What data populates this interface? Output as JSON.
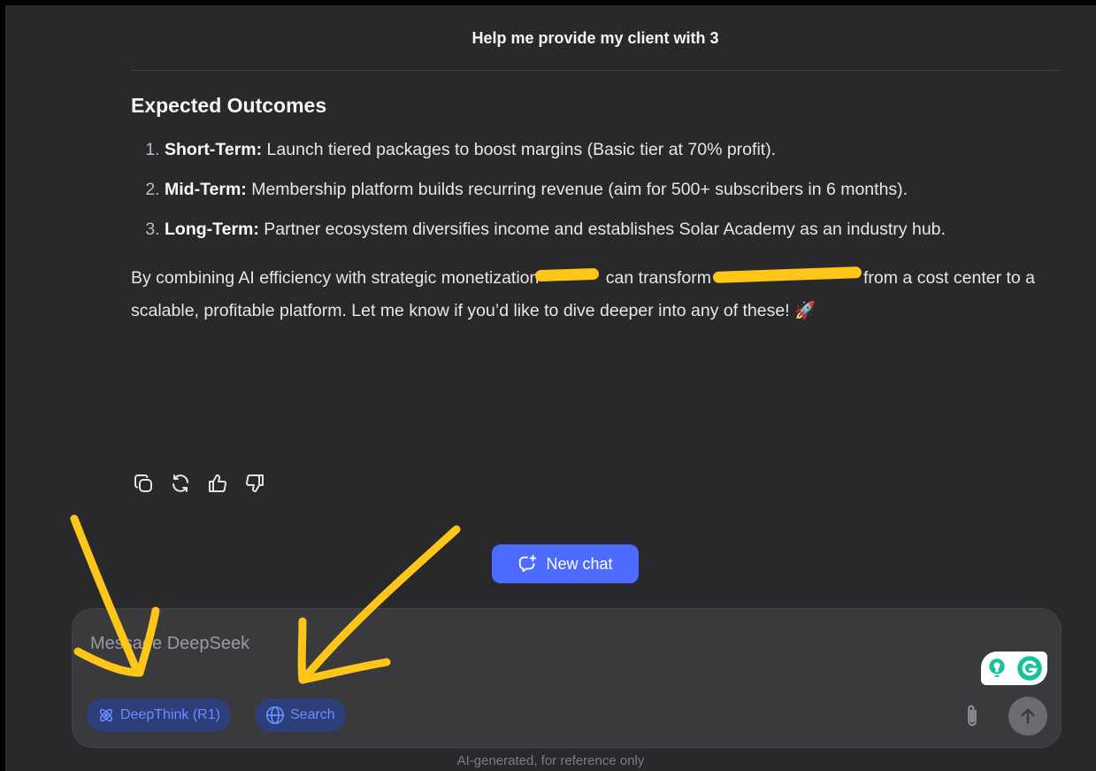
{
  "header": {
    "title": "Help me provide my client with 3"
  },
  "message": {
    "heading": "Expected Outcomes",
    "outcomes": [
      {
        "label": "Short-Term:",
        "text": " Launch tiered packages to boost margins (Basic tier at 70% profit)."
      },
      {
        "label": "Mid-Term:",
        "text": " Membership platform builds recurring revenue (aim for 500+ subscribers in 6 months)."
      },
      {
        "label": "Long-Term:",
        "text": " Partner ecosystem diversifies income and establishes Solar Academy as an industry hub."
      }
    ],
    "closing_part1": "By combining AI efficiency with strategic monetization",
    "closing_part2": " can transform",
    "closing_part3": "from a cost center to a scalable, profitable platform. Let me know if you’d like to dive deeper into any of these! 🚀"
  },
  "new_chat": {
    "label": "New chat"
  },
  "composer": {
    "placeholder": "Message DeepSeek",
    "deepthink_label": "DeepThink (R1)",
    "search_label": "Search"
  },
  "disclaimer": "AI-generated, for reference only",
  "colors": {
    "background": "#29292c",
    "accent": "#4d6bfe",
    "pill_bg": "#2c3f7a",
    "pill_text": "#6d8dff",
    "annotation": "#ffc61a",
    "grammarly": "#15c39a"
  },
  "icons": [
    "copy-icon",
    "regenerate-icon",
    "thumbs-up-icon",
    "thumbs-down-icon",
    "new-chat-icon",
    "atom-icon",
    "globe-icon",
    "paperclip-icon",
    "arrow-up-icon",
    "grammarly-icon",
    "lightbulb-icon"
  ]
}
